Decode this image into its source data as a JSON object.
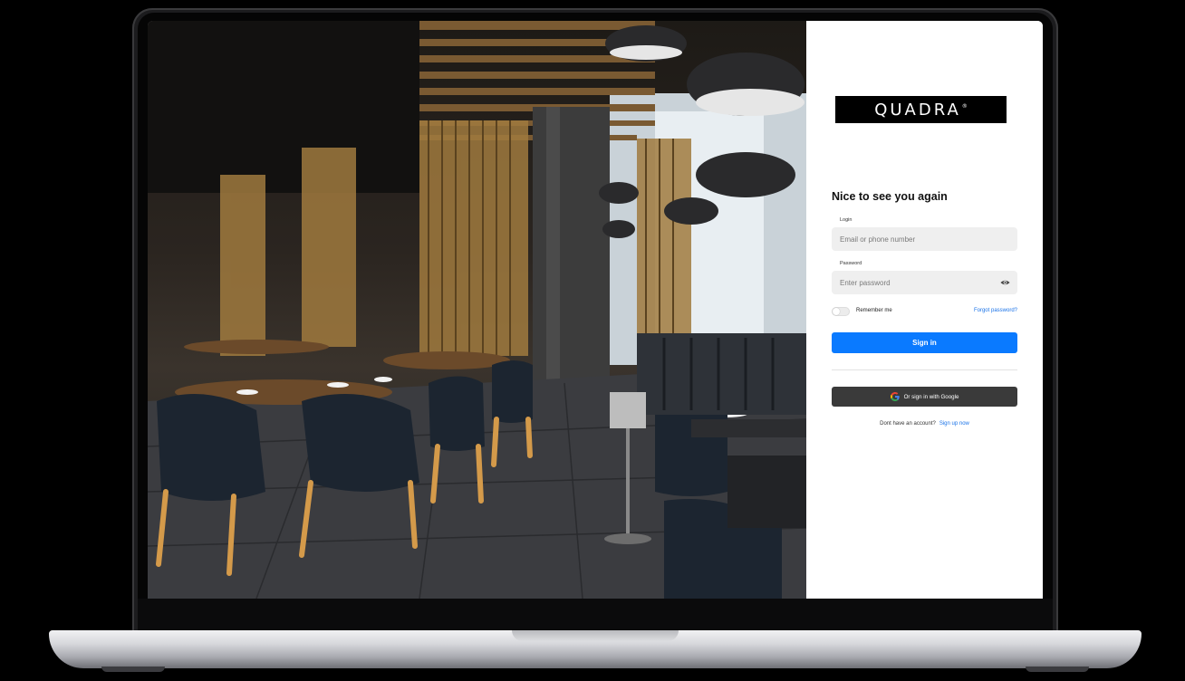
{
  "brand": {
    "name": "QUADRA",
    "mark": "®"
  },
  "login": {
    "heading": "Nice to see you again",
    "login_label": "Login",
    "login_placeholder": "Email or phone number",
    "password_label": "Password",
    "password_placeholder": "Enter password",
    "remember_label": "Remember me",
    "forgot_label": "Forgot password?",
    "signin_label": "Sign in",
    "google_label": "Or sign in with Google",
    "signup_prompt": "Dont have an account?",
    "signup_link": "Sign up now"
  },
  "colors": {
    "primary": "#0a7aff",
    "link": "#1a73e8",
    "google_button": "#3a3a3a",
    "field_bg": "#efefef"
  },
  "icons": {
    "password_toggle": "eye-icon",
    "google": "google-g-icon"
  }
}
